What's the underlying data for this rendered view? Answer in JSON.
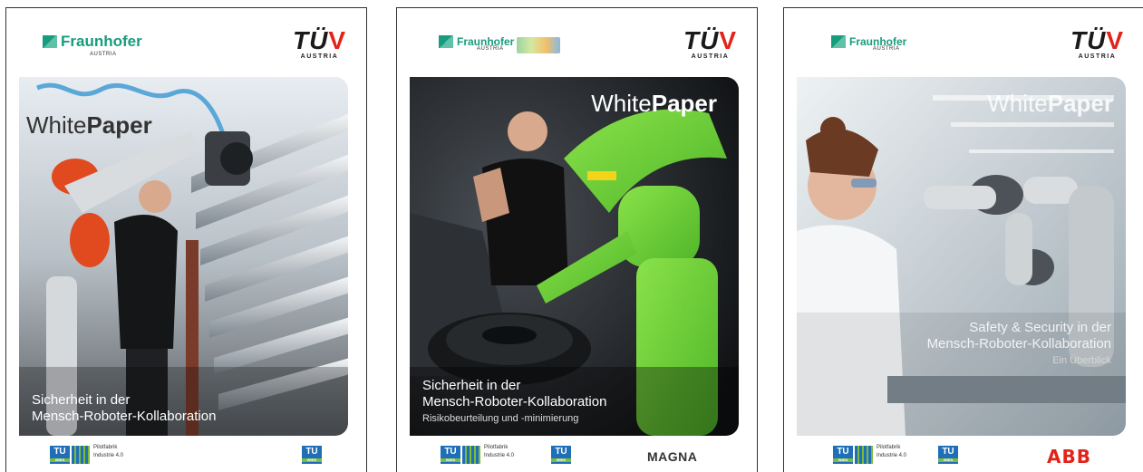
{
  "covers": [
    {
      "fraunhofer": "Fraunhofer",
      "fraunhofer_sub": "AUSTRIA",
      "tuv": "TÜ",
      "tuv_check": "V",
      "tuv_sub": "AUSTRIA",
      "wp_light": "White",
      "wp_bold": "Paper",
      "caption_line1": "Sicherheit in der",
      "caption_line2": "Mensch-Roboter-Kollaboration",
      "tu_label": "TU",
      "tu_sub": "WIEN",
      "pilot_line1": "Pilotfabrik",
      "pilot_line2": "Industrie 4.0",
      "partner": ""
    },
    {
      "fraunhofer": "Fraunhofer",
      "fraunhofer_sub": "AUSTRIA",
      "tuv": "TÜ",
      "tuv_check": "V",
      "tuv_sub": "AUSTRIA",
      "wp_light": "White",
      "wp_bold": "Paper",
      "caption_line1": "Sicherheit in der",
      "caption_line2": "Mensch-Roboter-Kollaboration",
      "caption_sub": "Risikobeurteilung und -minimierung",
      "tu_label": "TU",
      "tu_sub": "WIEN",
      "pilot_line1": "Pilotfabrik",
      "pilot_line2": "Industrie 4.0",
      "partner": "MAGNA"
    },
    {
      "fraunhofer": "Fraunhofer",
      "fraunhofer_sub": "AUSTRIA",
      "tuv": "TÜ",
      "tuv_check": "V",
      "tuv_sub": "AUSTRIA",
      "wp_light": "White",
      "wp_bold": "Paper",
      "caption_line1": "Safety & Security in der",
      "caption_line2": "Mensch-Roboter-Kollaboration",
      "caption_sub": "Ein Überblick",
      "tu_label": "TU",
      "tu_sub": "WIEN",
      "pilot_line1": "Pilotfabrik",
      "pilot_line2": "Industrie 4.0",
      "partner": "ABB"
    }
  ],
  "colors": {
    "fraunhofer_green": "#179c7d",
    "tuv_red": "#e2231a",
    "robot_green": "#6fd23a",
    "robot_orange": "#e04a1e",
    "tu_blue": "#1f6fb8"
  }
}
